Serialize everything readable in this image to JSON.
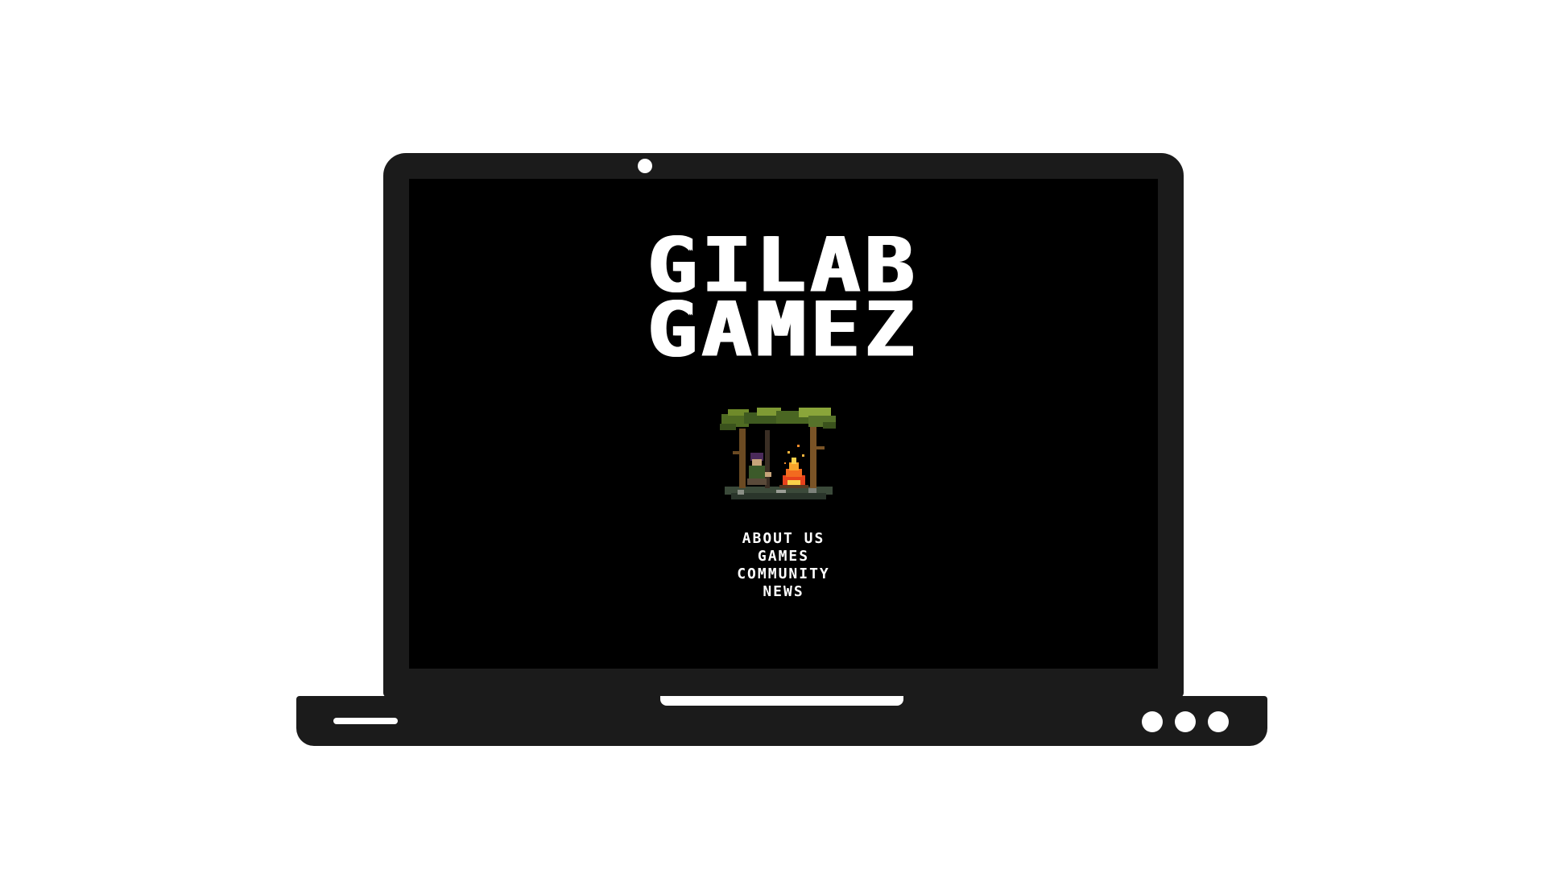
{
  "site": {
    "title_line_1": "GILAB",
    "title_line_2": "GAMEZ"
  },
  "hero_image": {
    "icon": "campfire-forest-pixel-art"
  },
  "nav": {
    "items": [
      {
        "label": "ABOUT US"
      },
      {
        "label": "GAMES"
      },
      {
        "label": "COMMUNITY"
      },
      {
        "label": "NEWS"
      }
    ]
  },
  "colors": {
    "device": "#1b1b1b",
    "screen_background": "#000000",
    "text": "#ffffff",
    "page_background": "#ffffff"
  }
}
